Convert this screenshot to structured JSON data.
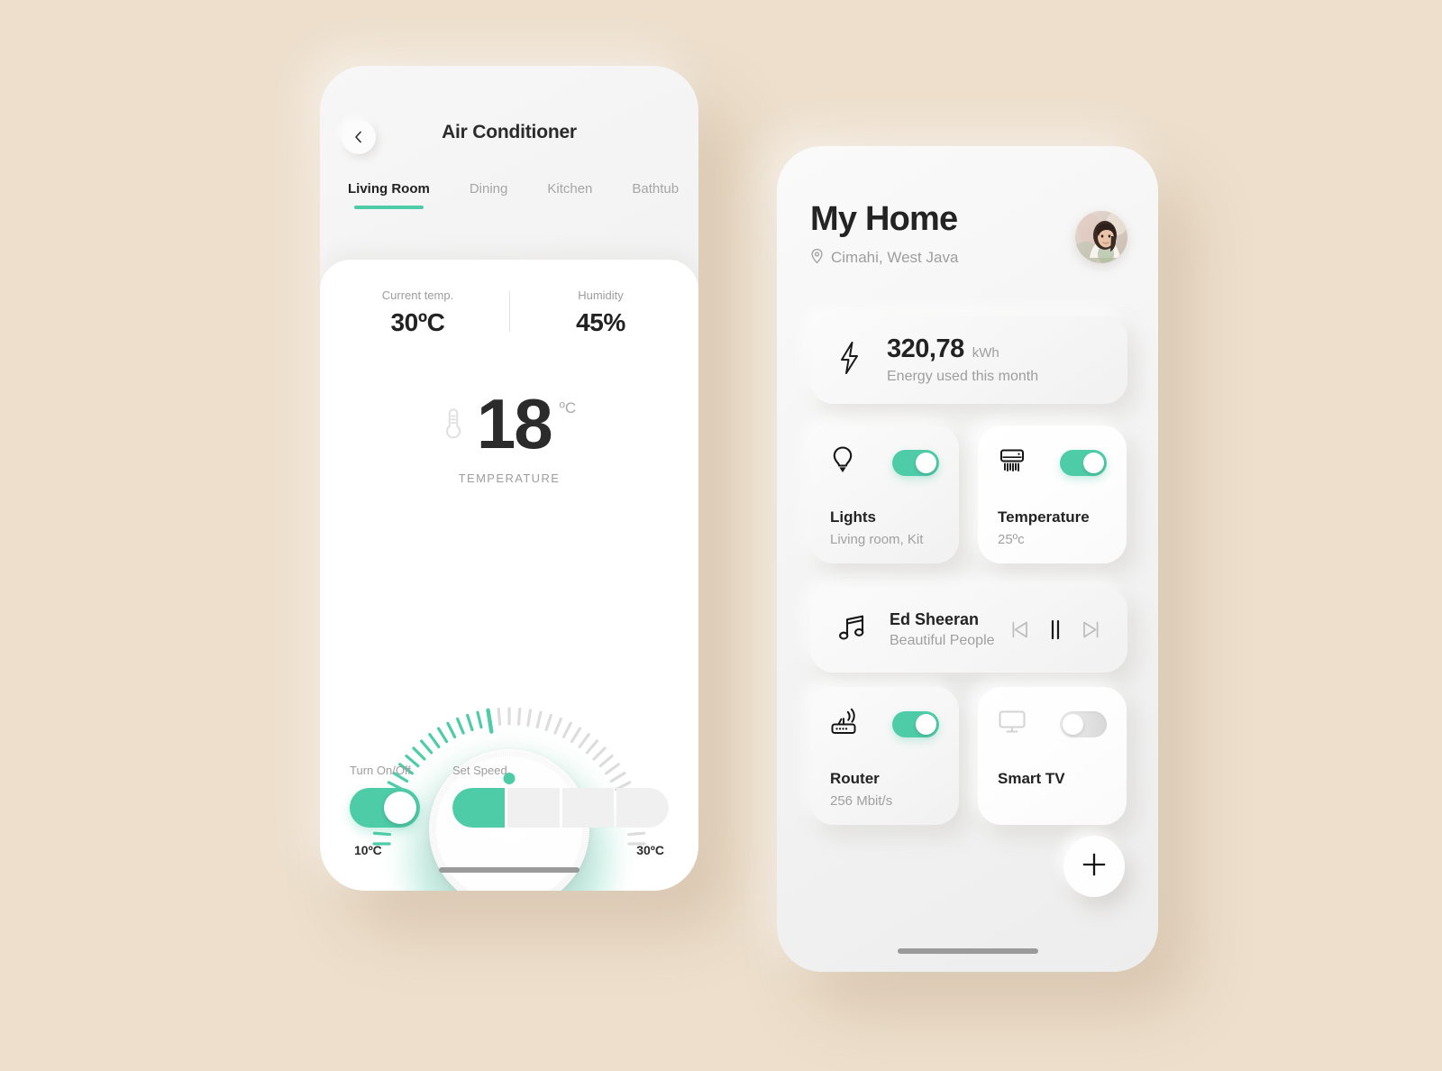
{
  "theme": {
    "background": "#EDDFCC",
    "accent": "#4ECCA8",
    "text_dark": "#232323",
    "text_muted": "#9E9E9E"
  },
  "ac_screen": {
    "back_icon": "chevron-left-icon",
    "title": "Air Conditioner",
    "tabs": [
      {
        "label": "Living Room",
        "active": true
      },
      {
        "label": "Dining",
        "active": false
      },
      {
        "label": "Kitchen",
        "active": false
      },
      {
        "label": "Bathtub",
        "active": false
      }
    ],
    "stats": [
      {
        "label": "Current temp.",
        "value": "30ºC"
      },
      {
        "label": "Humidity",
        "value": "45%"
      }
    ],
    "thermostat": {
      "icon": "thermometer-icon",
      "value": "18",
      "unit": "ºC",
      "caption": "TEMPERATURE"
    },
    "dial": {
      "min_label": "10ºC",
      "max_label": "30ºC",
      "min_value": 10,
      "max_value": 30,
      "current_value": 18,
      "total_ticks": 41,
      "active_ticks": 18
    },
    "controls": {
      "power_label": "Turn On/Off",
      "power_on": true,
      "speed_label": "Set Speed",
      "speed_segments": 4,
      "speed_active": 1
    }
  },
  "home_screen": {
    "title": "My Home",
    "location_icon": "map-pin-icon",
    "location": "Cimahi, West Java",
    "avatar_name": "avatar",
    "energy": {
      "icon": "lightning-bolt-icon",
      "value": "320,78",
      "unit": "kWh",
      "subtitle": "Energy used this month"
    },
    "devices": [
      {
        "icon": "light-bulb-icon",
        "name": "Lights",
        "detail": "Living room, Kit",
        "on": true
      },
      {
        "icon": "air-conditioner-icon",
        "name": "Temperature",
        "detail": "25ºc",
        "on": true
      },
      {
        "icon": "router-icon",
        "name": "Router",
        "detail": "256 Mbit/s",
        "on": true
      },
      {
        "icon": "tv-icon",
        "name": "Smart TV",
        "detail": "",
        "on": false
      }
    ],
    "music": {
      "icon": "music-note-icon",
      "artist": "Ed Sheeran",
      "track": "Beautiful People",
      "prev_icon": "skip-previous-icon",
      "play_icon": "pause-icon",
      "next_icon": "skip-next-icon",
      "playing": true
    },
    "add_button_icon": "plus-icon"
  }
}
